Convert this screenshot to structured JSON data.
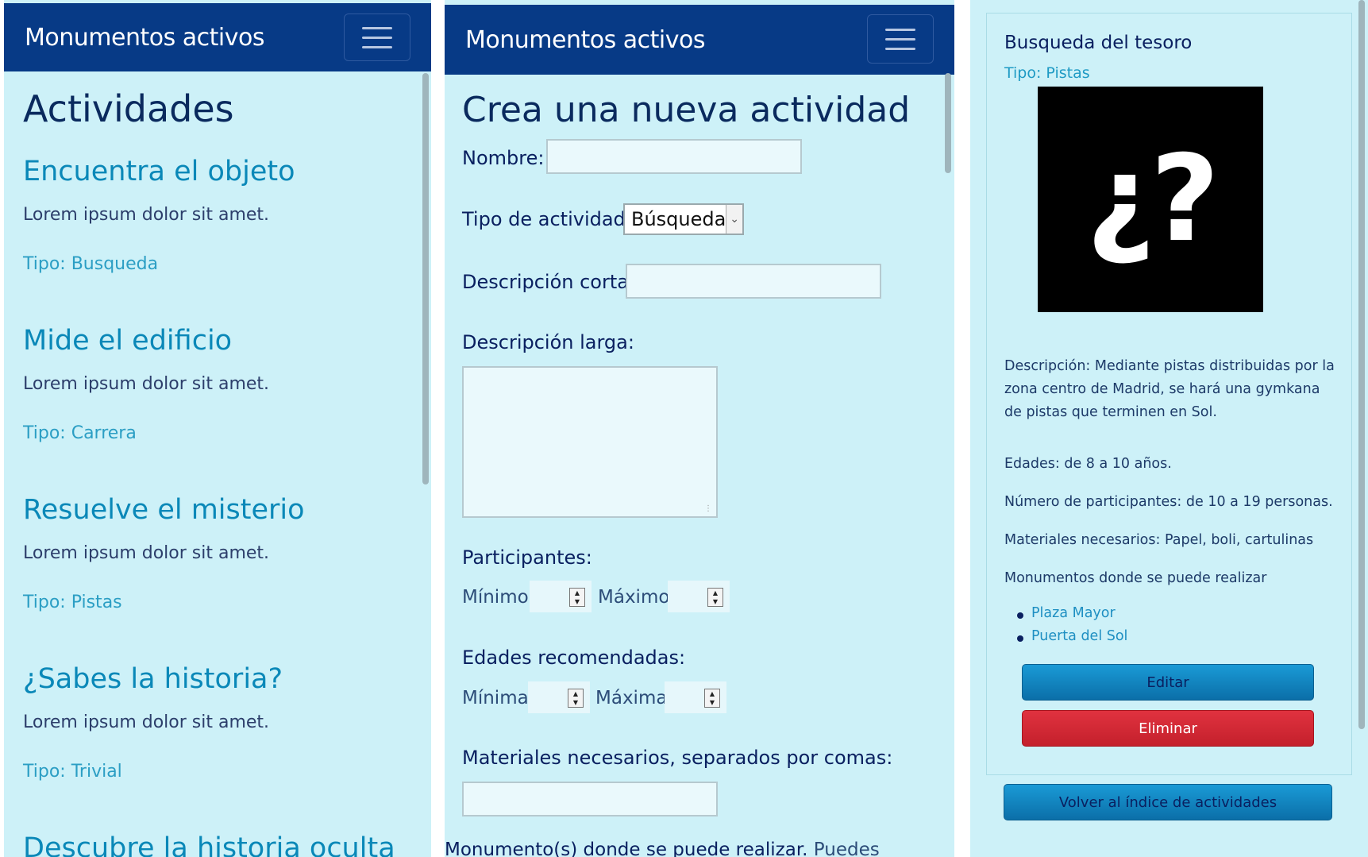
{
  "brand": "Monumentos activos",
  "list_page": {
    "heading": "Actividades",
    "activities": [
      {
        "title": "Encuentra el objeto",
        "desc": "Lorem ipsum dolor sit amet.",
        "type": "Tipo: Busqueda"
      },
      {
        "title": "Mide el edificio",
        "desc": "Lorem ipsum dolor sit amet.",
        "type": "Tipo: Carrera"
      },
      {
        "title": "Resuelve el misterio",
        "desc": "Lorem ipsum dolor sit amet.",
        "type": "Tipo: Pistas"
      },
      {
        "title": "¿Sabes la historia?",
        "desc": "Lorem ipsum dolor sit amet.",
        "type": "Tipo: Trivial"
      },
      {
        "title": "Descubre la historia oculta",
        "desc": "",
        "type": ""
      }
    ]
  },
  "form_page": {
    "heading": "Crea una nueva actividad",
    "name_label": "Nombre:",
    "name_value": "",
    "type_label": "Tipo de actividad:",
    "type_selected": "Búsqueda",
    "short_desc_label": "Descripción corta:",
    "long_desc_label": "Descripción larga:",
    "participants_label": "Participantes:",
    "min_label": "Mínimo:",
    "max_label": "Máximo:",
    "ages_label": "Edades recomendadas:",
    "min_age_label": "Mínima:",
    "max_age_label": "Máxima:",
    "materials_label": "Materiales necesarios, separados por comas:",
    "monuments_label": "Monumento(s) donde se puede realizar.",
    "monuments_hint": "Puedes"
  },
  "detail_page": {
    "title": "Busqueda del tesoro",
    "type": "Tipo: Pistas",
    "image_glyph": "¿?",
    "description": "Descripción: Mediante pistas distribuidas por la zona centro de Madrid, se hará una gymkana de pistas que terminen en Sol.",
    "ages": "Edades: de 8 a 10 años.",
    "participants": "Número de participantes: de 10 a 19 personas.",
    "materials": "Materiales necesarios: Papel, boli, cartulinas",
    "monuments_heading": "Monumentos donde se puede realizar",
    "monuments": [
      "Plaza Mayor",
      "Puerta del Sol"
    ],
    "edit_label": "Editar",
    "delete_label": "Eliminar",
    "back_label": "Volver al índice de actividades"
  }
}
